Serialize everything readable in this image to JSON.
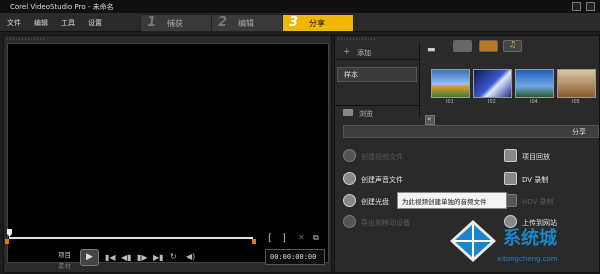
{
  "window": {
    "title": "Corel VideoStudio Pro - 未命名"
  },
  "menu": [
    "文件",
    "编辑",
    "工具",
    "设置"
  ],
  "steps": [
    {
      "num": "1",
      "label": "捕获"
    },
    {
      "num": "2",
      "label": "编辑"
    },
    {
      "num": "3",
      "label": "分享"
    }
  ],
  "library": {
    "add_label": "添加",
    "sample_label": "样本",
    "browse_label": "浏览",
    "thumbnails": [
      "I01",
      "I02",
      "I04",
      "I05"
    ]
  },
  "share": {
    "header": "分享",
    "options_left": [
      "创建视频文件",
      "创建声音文件",
      "创建光盘",
      "导出到移动设备"
    ],
    "options_right": [
      "项目回放",
      "DV 录制",
      "HDV 录制",
      "上传到网站"
    ],
    "tooltip": "为此视频创建单独的音频文件"
  },
  "player": {
    "project_label": "项目",
    "clip_label": "素材",
    "timecode": "00:00:00:00"
  },
  "watermark": {
    "word": "系统城",
    "url": "xitongcheng.com"
  },
  "colors": {
    "accent": "#f2b705",
    "watermark": "#1a86c9"
  }
}
